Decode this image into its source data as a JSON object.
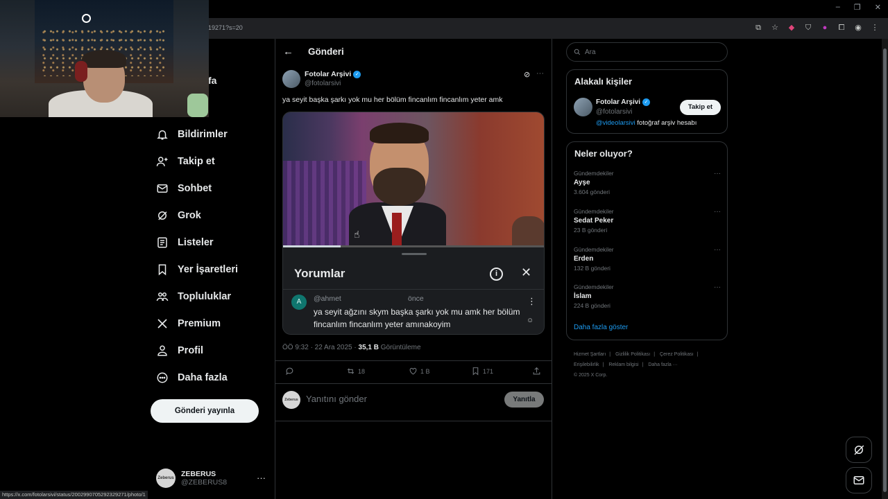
{
  "browser": {
    "url_fragment": "19271?s=20",
    "window_controls": [
      "–",
      "❐",
      "✕"
    ]
  },
  "nav": {
    "partial_label": "fa",
    "items": [
      {
        "label": "Bildirimler",
        "icon": "bell-icon"
      },
      {
        "label": "Takip et",
        "icon": "person-plus-icon"
      },
      {
        "label": "Sohbet",
        "icon": "mail-icon"
      },
      {
        "label": "Grok",
        "icon": "grok-icon"
      },
      {
        "label": "Listeler",
        "icon": "list-icon"
      },
      {
        "label": "Yer İşaretleri",
        "icon": "bookmark-icon"
      },
      {
        "label": "Topluluklar",
        "icon": "people-icon"
      },
      {
        "label": "Premium",
        "icon": "x-logo-icon"
      },
      {
        "label": "Profil",
        "icon": "profile-icon"
      },
      {
        "label": "Daha fazla",
        "icon": "more-circle-icon"
      }
    ],
    "post_button": "Gönderi yayınla",
    "account": {
      "name": "ZEBERUS",
      "handle": "@ZEBERUS8",
      "avatar_text": "Zeberus",
      "more": "···"
    }
  },
  "status_bar_url": "https://x.com/fotolarsivi/status/2002990705292329271/photo/1",
  "header": {
    "back": "←",
    "title": "Gönderi"
  },
  "tweet": {
    "author_name": "Fotolar Arşivi",
    "author_handle": "@fotolarsivi",
    "text": "ya seyit başka şarkı yok mu her bölüm fincanlım fincanlım yeter amk",
    "video_progress": 0.22,
    "comments_sheet": {
      "title": "Yorumlar",
      "info": "i",
      "close": "✕",
      "comment": {
        "avatar_letter": "A",
        "user": "@ahmet",
        "time": "önce",
        "text": "ya seyit ağzını skym başka şarkı yok mu amk her bölüm fincanlım fincanlım yeter amınakoyim"
      }
    },
    "meta": {
      "time_date": "ÖÖ 9:32 · 22 Ara 2025 · ",
      "views": "35,1 B",
      "views_label": " Görüntüleme"
    },
    "actions": {
      "reposts": "18",
      "likes": "1 B",
      "bookmarks": "171"
    }
  },
  "reply": {
    "placeholder": "Yanıtını gönder",
    "button": "Yanıtla",
    "avatar_text": "Zeberus"
  },
  "search": {
    "placeholder": "Ara"
  },
  "related": {
    "title": "Alakalı kişiler",
    "person": {
      "name": "Fotolar Arşivi",
      "handle": "@fotolarsivi",
      "follow": "Takip et",
      "bio_mention": "@videolarsivi",
      "bio_rest": " fotoğraf arşiv hesabı"
    }
  },
  "trends": {
    "title": "Neler oluyor?",
    "items": [
      {
        "category": "Gündemdekiler",
        "name": "Ayşe",
        "count": "3.604 gönderi"
      },
      {
        "category": "Gündemdekiler",
        "name": "Sedat Peker",
        "count": "23 B gönderi"
      },
      {
        "category": "Gündemdekiler",
        "name": "Erden",
        "count": "132 B gönderi"
      },
      {
        "category": "Gündemdekiler",
        "name": "İslam",
        "count": "224 B gönderi"
      }
    ],
    "show_more": "Daha fazla göster"
  },
  "footer": {
    "links": [
      "Hizmet Şartları",
      "|",
      "Gizlilik Politikası",
      "|",
      "Çerez Politikası",
      "|",
      "Erişilebilirlik",
      "|",
      "Reklam bilgisi",
      "|",
      "Daha fazla ···"
    ],
    "copyright": "© 2025 X Corp."
  },
  "colors": {
    "accent": "#1d9bf0",
    "background": "#000000",
    "border": "#2f3336",
    "muted": "#71767b"
  }
}
